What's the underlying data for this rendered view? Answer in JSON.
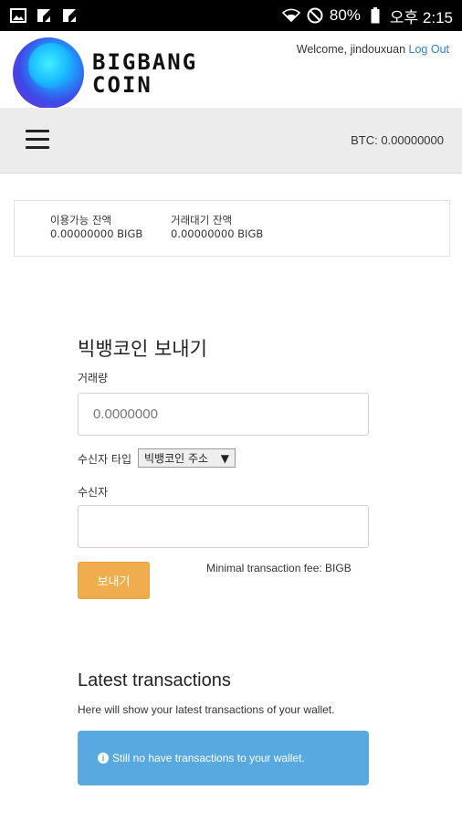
{
  "status_bar": {
    "battery": "80%",
    "time": "오후 2:15",
    "icons": [
      "image-icon",
      "notification-icon",
      "notification-icon",
      "wifi-icon",
      "do-not-disturb-icon",
      "battery-icon"
    ]
  },
  "header": {
    "logo_line1": "BIGBANG",
    "logo_line2": "COIN",
    "welcome_text": "Welcome, jindouxuan",
    "logout_label": "Log Out"
  },
  "navbar": {
    "menu_icon": "hamburger-menu-icon",
    "btc_balance": "BTC: 0.00000000"
  },
  "balances": {
    "available_label": "이용가능 잔액",
    "available_value": "0.00000000 BIGB",
    "pending_label": "거래대기 잔액",
    "pending_value": "0.00000000 BIGB"
  },
  "send_form": {
    "title": "빅뱅코인 보내기",
    "amount_label": "거래량",
    "amount_placeholder": "0.0000000",
    "recipient_type_label": "수신자 타입",
    "recipient_type_selected": "빅뱅코인 주소",
    "recipient_label": "수신자",
    "recipient_placeholder": "",
    "send_button": "보내기",
    "fee_text": "Minimal transaction fee: BIGB"
  },
  "transactions": {
    "title": "Latest transactions",
    "description": "Here will show your latest transactions of your wallet.",
    "empty_message": "Still no have transactions to your wallet."
  },
  "colors": {
    "primary_button": "#f0ad4e",
    "info_alert": "#59a9e1",
    "link": "#2f7fd3"
  }
}
